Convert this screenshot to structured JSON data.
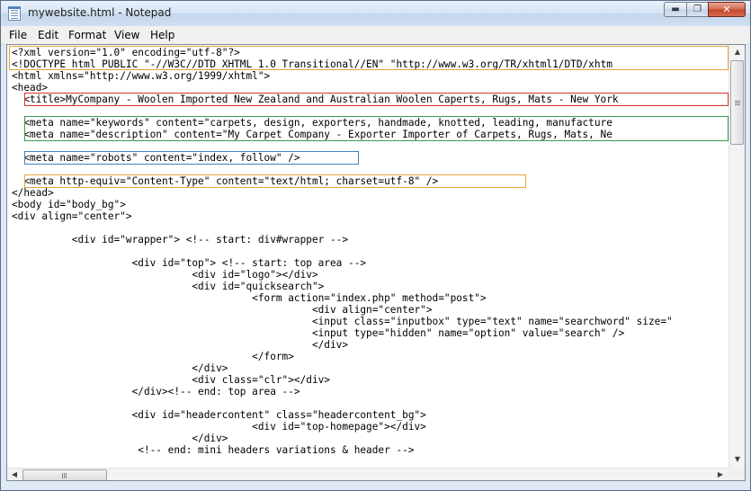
{
  "window": {
    "title": "mywebsite.html - Notepad"
  },
  "controls": {
    "minimize": "▬",
    "maximize": "❐",
    "close": "✕"
  },
  "menu": [
    "File",
    "Edit",
    "Format",
    "View",
    "Help"
  ],
  "editor": {
    "lines": [
      "<?xml version=\"1.0\" encoding=\"utf-8\"?>",
      "<!DOCTYPE html PUBLIC \"-//W3C//DTD XHTML 1.0 Transitional//EN\" \"http://www.w3.org/TR/xhtml1/DTD/xhtm",
      "<html xmlns=\"http://www.w3.org/1999/xhtml\">",
      "<head>",
      "  <title>MyCompany - Woolen Imported New Zealand and Australian Woolen Caperts, Rugs, Mats - New York",
      "",
      "  <meta name=\"keywords\" content=\"carpets, design, exporters, handmade, knotted, leading, manufacture",
      "  <meta name=\"description\" content=\"My Carpet Company - Exporter Importer of Carpets, Rugs, Mats, Ne",
      "",
      "  <meta name=\"robots\" content=\"index, follow\" />",
      "",
      "  <meta http-equiv=\"Content-Type\" content=\"text/html; charset=utf-8\" />",
      "</head>",
      "<body id=\"body_bg\">",
      "<div align=\"center\">",
      "",
      "          <div id=\"wrapper\"> <!-- start: div#wrapper -->",
      "",
      "                    <div id=\"top\"> <!-- start: top area -->",
      "                              <div id=\"logo\"></div>",
      "                              <div id=\"quicksearch\">",
      "                                        <form action=\"index.php\" method=\"post\">",
      "                                                  <div align=\"center\">",
      "                                                  <input class=\"inputbox\" type=\"text\" name=\"searchword\" size=\"",
      "                                                  <input type=\"hidden\" name=\"option\" value=\"search\" />",
      "                                                  </div>",
      "                                        </form>",
      "                              </div>",
      "                              <div class=\"clr\"></div>",
      "                    </div><!-- end: top area -->",
      "",
      "                    <div id=\"headercontent\" class=\"headercontent_bg\">",
      "                                        <div id=\"top-homepage\"></div>",
      "                              </div>",
      "                     <!-- end: mini headers variations & header -->"
    ],
    "highlight_colors": {
      "orange": "#e8a33d",
      "red": "#d9362b",
      "green": "#3a9a4f",
      "blue": "#3f7fc0"
    }
  },
  "scrollbars": {
    "up": "▲",
    "down": "▼",
    "left": "◀",
    "right": "▶"
  }
}
